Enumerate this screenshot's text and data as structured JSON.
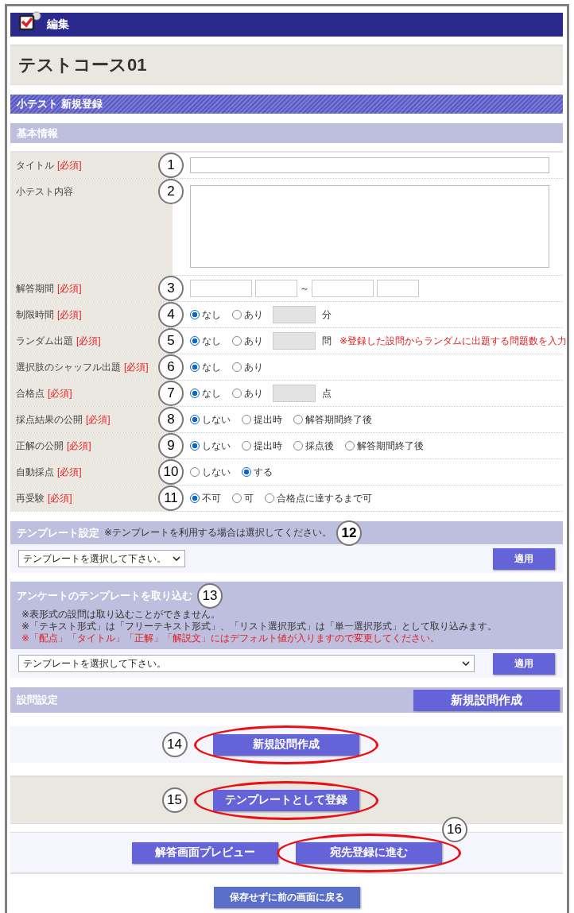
{
  "header": {
    "title": "編集"
  },
  "course_title": "テストコース01",
  "section_title": "小テスト 新規登録",
  "basic_info": {
    "heading": "基本情報",
    "rows": [
      {
        "label": "タイトル",
        "required": "[必須]",
        "badge": "1",
        "kind": "text"
      },
      {
        "label": "小テスト内容",
        "badge": "2",
        "kind": "textarea"
      },
      {
        "label": "解答期間",
        "required": "[必須]",
        "badge": "3",
        "kind": "period",
        "separator": "～"
      },
      {
        "label": "制限時間",
        "required": "[必須]",
        "badge": "4",
        "kind": "radio",
        "options": [
          {
            "label": "なし",
            "selected": true
          },
          {
            "label": "あり",
            "selected": false
          }
        ],
        "unit": "分"
      },
      {
        "label": "ランダム出題",
        "required": "[必須]",
        "badge": "5",
        "kind": "radio",
        "options": [
          {
            "label": "なし",
            "selected": true
          },
          {
            "label": "あり",
            "selected": false
          }
        ],
        "unit": "問",
        "note": "※登録した設問からランダムに出題する問題数を入力"
      },
      {
        "label": "選択肢のシャッフル出題",
        "required": "[必須]",
        "badge": "6",
        "kind": "radio",
        "options": [
          {
            "label": "なし",
            "selected": true
          },
          {
            "label": "あり",
            "selected": false
          }
        ]
      },
      {
        "label": "合格点",
        "required": "[必須]",
        "badge": "7",
        "kind": "radio",
        "options": [
          {
            "label": "なし",
            "selected": true
          },
          {
            "label": "あり",
            "selected": false
          }
        ],
        "unit": "点"
      },
      {
        "label": "採点結果の公開",
        "required": "[必須]",
        "badge": "8",
        "kind": "radio",
        "options": [
          {
            "label": "しない",
            "selected": true
          },
          {
            "label": "提出時",
            "selected": false
          },
          {
            "label": "解答期間終了後",
            "selected": false
          }
        ]
      },
      {
        "label": "正解の公開",
        "required": "[必須]",
        "badge": "9",
        "kind": "radio",
        "options": [
          {
            "label": "しない",
            "selected": true
          },
          {
            "label": "提出時",
            "selected": false
          },
          {
            "label": "採点後",
            "selected": false
          },
          {
            "label": "解答期間終了後",
            "selected": false
          }
        ]
      },
      {
        "label": "自動採点",
        "required": "[必須]",
        "badge": "10",
        "kind": "radio",
        "options": [
          {
            "label": "しない",
            "selected": false
          },
          {
            "label": "する",
            "selected": true
          }
        ]
      },
      {
        "label": "再受験",
        "required": "[必須]",
        "badge": "11",
        "kind": "radio",
        "options": [
          {
            "label": "不可",
            "selected": true
          },
          {
            "label": "可",
            "selected": false
          },
          {
            "label": "合格点に達するまで可",
            "selected": false
          }
        ]
      }
    ]
  },
  "template": {
    "heading": "テンプレート設定",
    "note": "※テンプレートを利用する場合は選択してください。",
    "badge": "12",
    "select": "テンプレートを選択して下さい。",
    "button": "適用"
  },
  "import": {
    "heading": "アンケートのテンプレートを取り込む",
    "badge": "13",
    "notes": [
      {
        "text": "※表形式の設問は取り込むことができません。",
        "kind": "info"
      },
      {
        "text": "※「テキスト形式」は「フリーテキスト形式」、「リスト選択形式」は「単一選択形式」として取り込みます。",
        "kind": "info"
      },
      {
        "text": "※「配点」「タイトル」「正解」「解説文」にはデフォルト値が入りますので変更してください。",
        "kind": "warning"
      }
    ],
    "select": "テンプレートを選択して下さい。",
    "button": "適用"
  },
  "questions": {
    "heading": "設問設定",
    "header_button": "新規設問作成",
    "button": {
      "label": "新規設問作成",
      "badge": "14",
      "highlighted": true
    }
  },
  "register": {
    "button": {
      "label": "テンプレートとして登録",
      "badge": "15",
      "highlighted": true
    }
  },
  "actions": [
    {
      "label": "解答画面プレビュー",
      "highlighted": false
    },
    {
      "label": "宛先登録に進む",
      "badge": "16",
      "highlighted": true
    }
  ],
  "back_button": "保存せずに前の画面に戻る"
}
